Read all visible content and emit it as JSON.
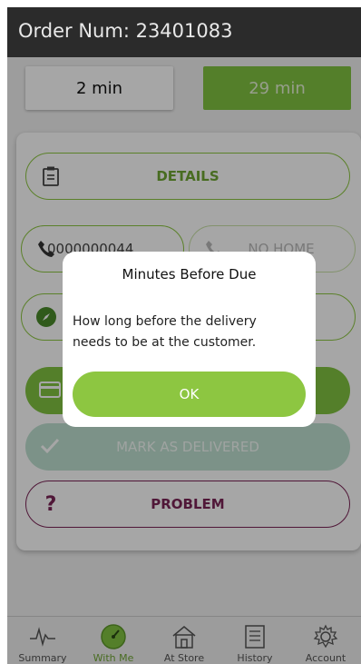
{
  "header": {
    "title": "Order Num: 23401083"
  },
  "timers": {
    "left": "2 min",
    "right": "29 min"
  },
  "actions": {
    "details": "DETAILS",
    "phone": "0000000044",
    "no_home": "NO HOME",
    "map": "MAP",
    "mark_delivered": "MARK AS DELIVERED",
    "problem": "PROBLEM"
  },
  "dialog": {
    "title": "Minutes Before Due",
    "message": "How long before the delivery needs to be at the customer.",
    "ok": "OK"
  },
  "nav": {
    "items": [
      {
        "label": "Summary",
        "icon": "pulse-icon"
      },
      {
        "label": "With Me",
        "icon": "speedometer-icon"
      },
      {
        "label": "At Store",
        "icon": "store-icon"
      },
      {
        "label": "History",
        "icon": "history-icon"
      },
      {
        "label": "Account",
        "icon": "gear-icon"
      }
    ],
    "active": "With Me"
  },
  "colors": {
    "accent": "#82c341",
    "problem": "#7b2457",
    "header": "#2b2b2b",
    "delivered": "#bfe0d1"
  }
}
